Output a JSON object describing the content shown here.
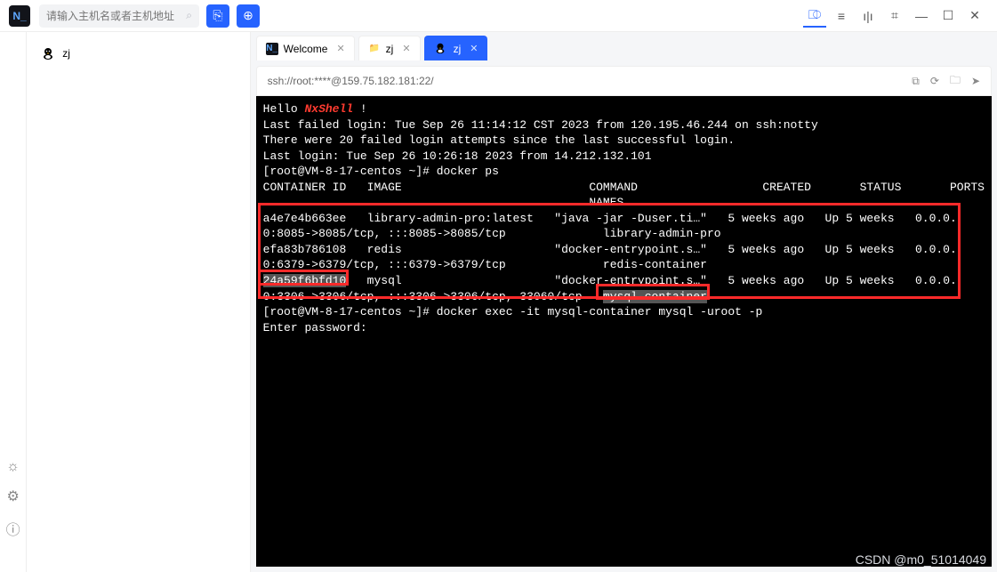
{
  "topbar": {
    "logo_text": "N_",
    "search_placeholder": "请输入主机名或者主机地址",
    "btn1_glyph": "⎘",
    "btn2_glyph": "⊕"
  },
  "top_icons": {
    "i1": "⎄",
    "i2": "≡",
    "i3": "ı|ı",
    "i4": "⌗",
    "min": "—",
    "max": "☐",
    "close": "✕"
  },
  "sidebar": {
    "item1": "zj"
  },
  "tabs": {
    "t0": {
      "label": "Welcome",
      "icon": "N_"
    },
    "t1": {
      "label": "zj"
    },
    "t2": {
      "label": "zj"
    }
  },
  "pathbar": {
    "text": "ssh://root:****@159.75.182.181:22/"
  },
  "terminal": {
    "l0a": "Hello ",
    "l0b": "NxShell",
    "l0c": " !",
    "l1": "Last failed login: Tue Sep 26 11:14:12 CST 2023 from 120.195.46.244 on ssh:notty",
    "l2": "There were 20 failed login attempts since the last successful login.",
    "l3": "Last login: Tue Sep 26 10:26:18 2023 from 14.212.132.101",
    "l4": "[root@VM-8-17-centos ~]# docker ps",
    "l5": "CONTAINER ID   IMAGE                           COMMAND                  CREATED       STATUS       PORTS",
    "l5b": "                                               NAMES",
    "l6": "a4e7e4b663ee   library-admin-pro:latest   \"java -jar -Duser.ti…\"   5 weeks ago   Up 5 weeks   0.0.0.",
    "l7": "0:8085->8085/tcp, :::8085->8085/tcp              library-admin-pro",
    "l8": "efa83b786108   redis                      \"docker-entrypoint.s…\"   5 weeks ago   Up 5 weeks   0.0.0.",
    "l9": "0:6379->6379/tcp, :::6379->6379/tcp              redis-container",
    "l10a": "24a59f6bfd10",
    "l10b": "   mysql                      \"docker-entrypoint.s…\"   5 weeks ago   Up 5 weeks   0.0.0.",
    "l11a": "0:3306->3306/tcp, :::3306->3306/tcp, 33060/tcp   ",
    "l11b": "mysql-container",
    "l12": "[root@VM-8-17-centos ~]# docker exec -it mysql-container mysql -uroot -p",
    "l13": "Enter password:"
  },
  "watermark": "CSDN @m0_51014049"
}
